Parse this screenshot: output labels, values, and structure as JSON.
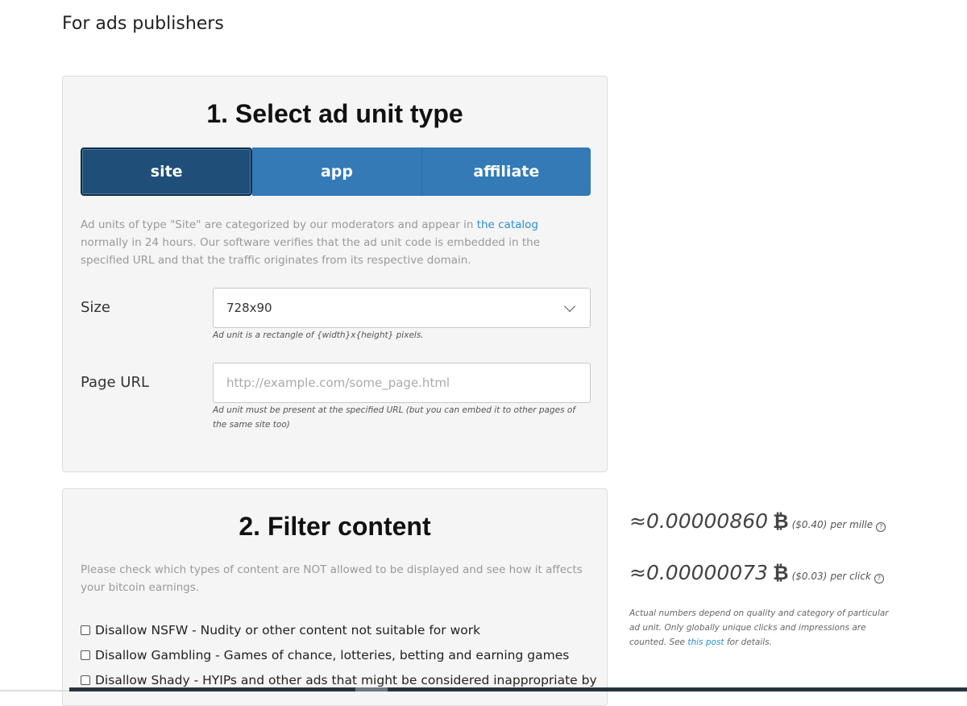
{
  "page": {
    "heading": "For ads publishers"
  },
  "section1": {
    "title": "1. Select ad unit type",
    "types": [
      {
        "label": "site",
        "active": true
      },
      {
        "label": "app",
        "active": false
      },
      {
        "label": "affiliate",
        "active": false
      }
    ],
    "description_pre": "Ad units of type \"Site\" are categorized by our moderators and appear in ",
    "description_link": "the catalog",
    "description_post": " normally in 24 hours. Our software verifies that the ad unit code is embedded in the specified URL and that the traffic originates from its respective domain.",
    "size_label": "Size",
    "size_value": "728x90",
    "size_help": "Ad unit is a rectangle of {width}x{height} pixels.",
    "url_label": "Page URL",
    "url_placeholder": "http://example.com/some_page.html",
    "url_value": "",
    "url_help": "Ad unit must be present at the specified URL (but you can embed it to other pages of the same site too)"
  },
  "section2": {
    "title": "2. Filter content",
    "description": "Please check which types of content are NOT allowed to be displayed and see how it affects your bitcoin earnings.",
    "options": [
      {
        "label": "Disallow NSFW - Nudity or other content not suitable for work",
        "checked": false
      },
      {
        "label": "Disallow Gambling - Games of chance, lotteries, betting and earning games",
        "checked": false
      },
      {
        "label": "Disallow Shady - HYIPs and other ads that might be considered inappropriate by",
        "checked": false
      }
    ]
  },
  "earnings": {
    "mille_amount": "≈0.00000860",
    "mille_usd": "($0.40)",
    "mille_unit": "per mille",
    "click_amount": "≈0.00000073",
    "click_usd": "($0.03)",
    "click_unit": "per click",
    "btc_symbol": "₿",
    "help_icon": "question-circle-icon",
    "note_pre": "Actual numbers depend on quality and category of particular ad unit. Only globally unique clicks and impressions are counted. See ",
    "note_link": "this post",
    "note_post": " for details."
  }
}
